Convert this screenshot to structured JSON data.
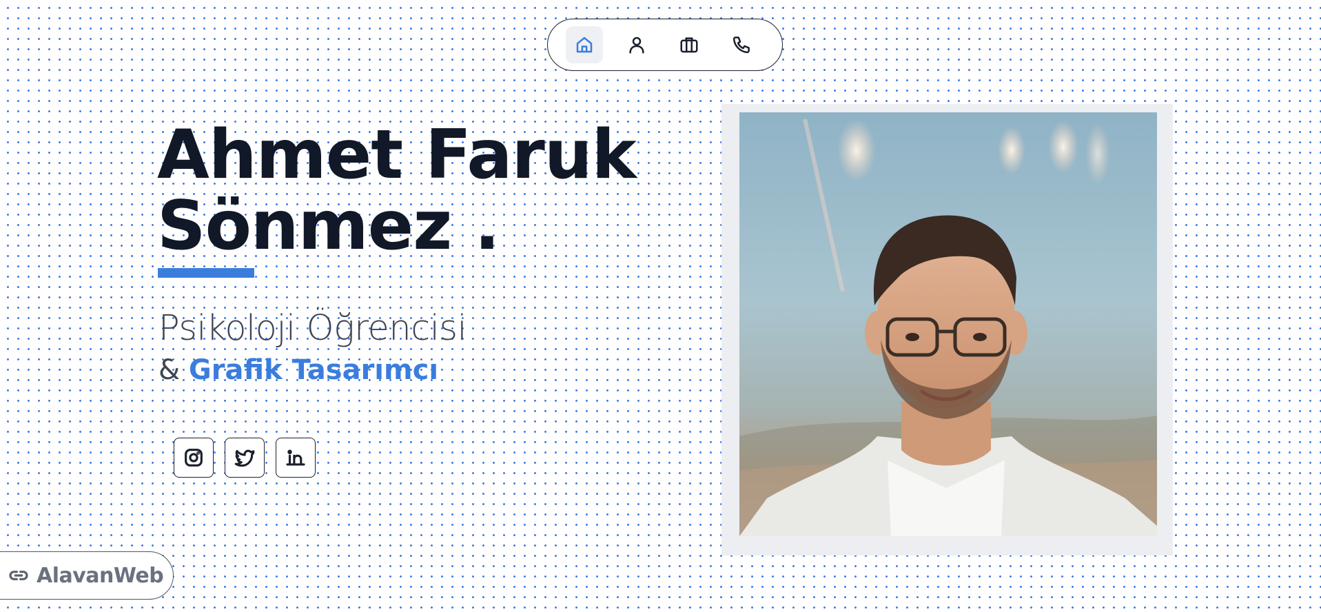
{
  "nav": {
    "items": [
      {
        "icon": "home-icon",
        "active": true
      },
      {
        "icon": "user-icon",
        "active": false
      },
      {
        "icon": "briefcase-icon",
        "active": false
      },
      {
        "icon": "phone-icon",
        "active": false
      }
    ],
    "active_color": "#3b7ddd"
  },
  "hero": {
    "name_line1": "Ahmet Faruk",
    "name_line2": "Sönmez .",
    "role_line1": "Psikoloji Öğrencisi",
    "role_prefix": "&",
    "role_accent": "Grafik Tasarımcı",
    "accent_color": "#3b7ddd"
  },
  "socials": [
    {
      "icon": "instagram-icon"
    },
    {
      "icon": "twitter-icon"
    },
    {
      "icon": "linkedin-icon"
    }
  ],
  "badge": {
    "icon": "link-icon",
    "label": "AlavanWeb"
  }
}
